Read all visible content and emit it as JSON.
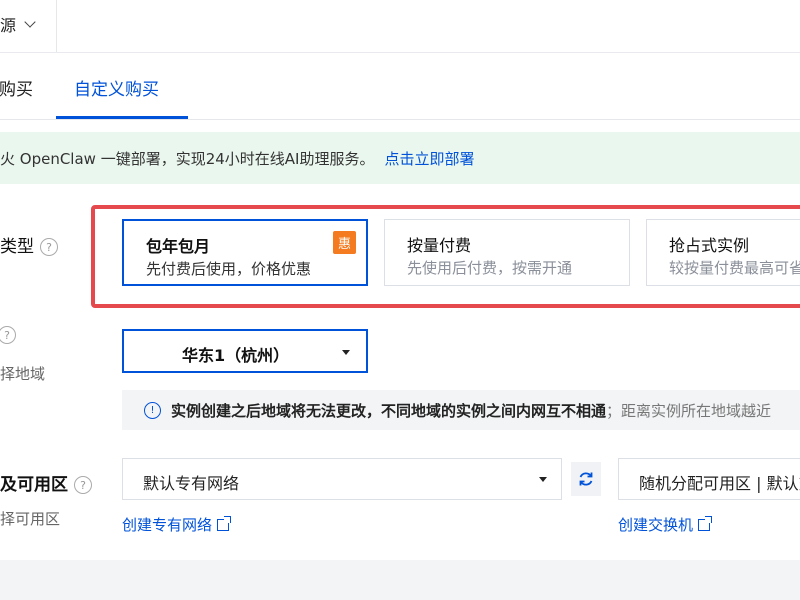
{
  "top": {
    "source_label": "源"
  },
  "tabs": [
    {
      "label": "购买"
    },
    {
      "label": "自定义购买"
    }
  ],
  "notice": {
    "text": "火 OpenClaw 一键部署，实现24小时在线AI助理服务。",
    "link": "点击立即部署",
    "bg_color": "#eaf7ee"
  },
  "billing": {
    "label": "类型",
    "options": [
      {
        "title": "包年包月",
        "desc": "先付费后使用，价格优惠",
        "badge": "惠",
        "selected": true
      },
      {
        "title": "按量付费",
        "desc": "先使用后付费，按需开通",
        "selected": false
      },
      {
        "title": "抢占式实例",
        "desc": "较按量付费最高可省",
        "selected": false
      }
    ]
  },
  "region": {
    "sublabel": "择地域",
    "selected": "华东1（杭州）",
    "info_strong": "实例创建之后地域将无法更改，不同地域的实例之间内网互不相通",
    "info_muted": "；距离实例所在地域越近"
  },
  "network": {
    "label": "及可用区",
    "sublabel": "择可用区",
    "vpc_value": "默认专有网络",
    "vpc_link": "创建专有网络",
    "zone_value": "随机分配可用区 | 默认交换机",
    "zone_link": "创建交换机"
  },
  "colors": {
    "primary": "#0052d9",
    "highlight_red": "#e5484d",
    "badge_orange": "#f47b20"
  }
}
